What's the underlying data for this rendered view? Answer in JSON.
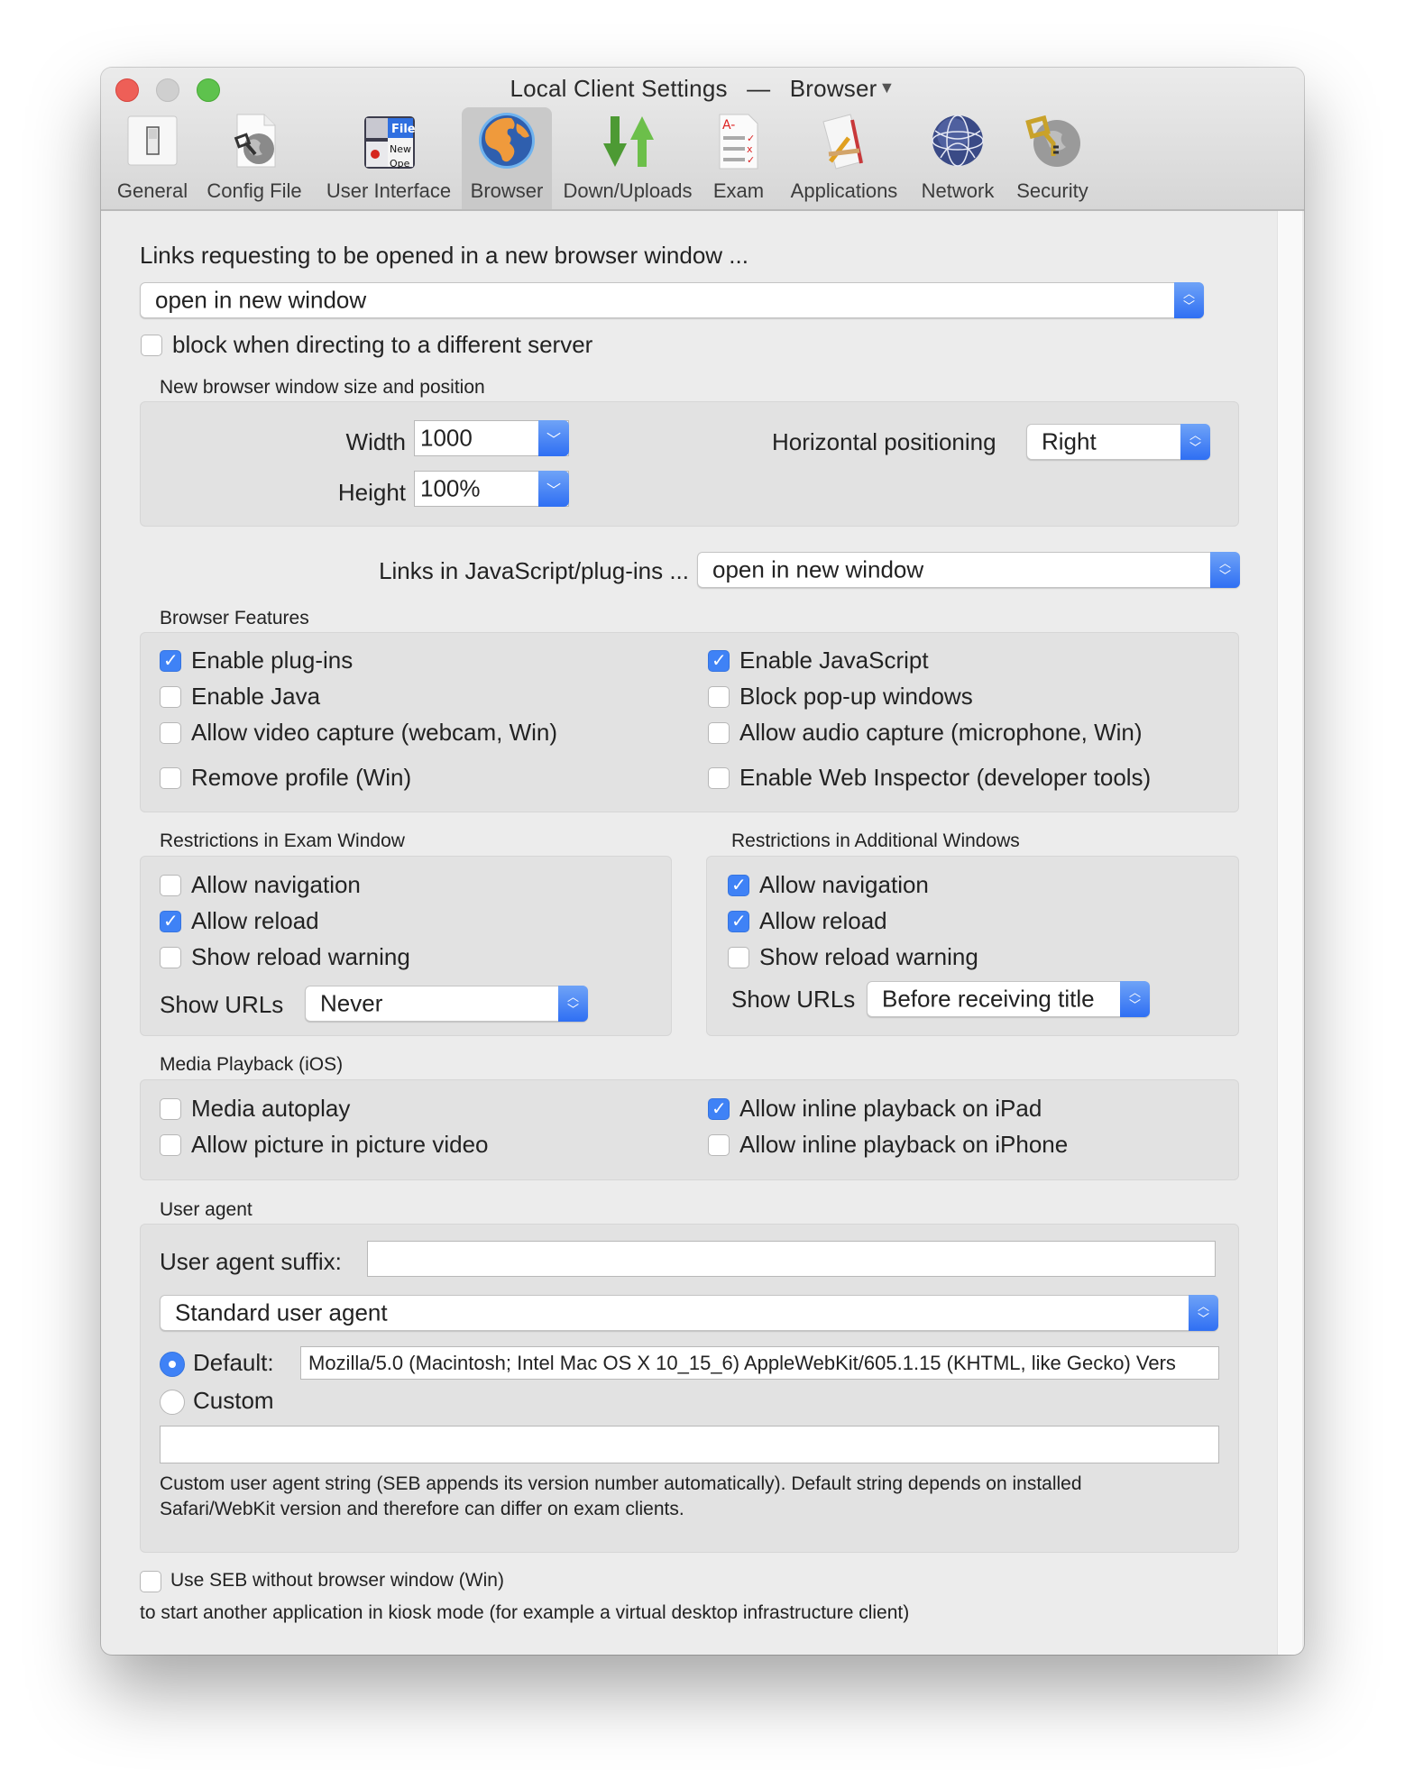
{
  "window": {
    "title": "Local Client Settings",
    "title_separator": "—",
    "subtitle": "Browser",
    "title_menu_icon": "▼"
  },
  "toolbar": {
    "items": [
      {
        "label": "General",
        "icon": "switch-icon",
        "selected": false
      },
      {
        "label": "Config File",
        "icon": "config-file-icon",
        "selected": false
      },
      {
        "label": "User Interface",
        "icon": "user-interface-icon",
        "selected": false
      },
      {
        "label": "Browser",
        "icon": "globe-icon",
        "selected": true
      },
      {
        "label": "Down/Uploads",
        "icon": "down-up-arrows-icon",
        "selected": false
      },
      {
        "label": "Exam",
        "icon": "exam-sheet-icon",
        "selected": false
      },
      {
        "label": "Applications",
        "icon": "applications-icon",
        "selected": false
      },
      {
        "label": "Network",
        "icon": "network-globe-icon",
        "selected": false
      },
      {
        "label": "Security",
        "icon": "security-key-icon",
        "selected": false
      }
    ]
  },
  "new_window_links": {
    "heading": "Links requesting to be opened in a new browser window ...",
    "policy_value": "open in new window",
    "block_label": "block when directing to a different server",
    "block_checked": false
  },
  "window_size": {
    "group_label": "New browser window size and position",
    "width_label": "Width",
    "width_value": "1000",
    "height_label": "Height",
    "height_value": "100%",
    "hpos_label": "Horizontal positioning",
    "hpos_value": "Right"
  },
  "js_links": {
    "label": "Links in JavaScript/plug-ins ...",
    "value": "open in new window"
  },
  "browser_features": {
    "group_label": "Browser Features",
    "left": [
      {
        "label": "Enable plug-ins",
        "checked": true
      },
      {
        "label": "Enable Java",
        "checked": false
      },
      {
        "label": "Allow video capture (webcam, Win)",
        "checked": false
      },
      {
        "label": "Remove profile (Win)",
        "checked": false
      }
    ],
    "right": [
      {
        "label": "Enable JavaScript",
        "checked": true
      },
      {
        "label": "Block pop-up windows",
        "checked": false
      },
      {
        "label": "Allow audio capture (microphone, Win)",
        "checked": false
      },
      {
        "label": "Enable Web Inspector (developer tools)",
        "checked": false
      }
    ]
  },
  "exam_restrictions": {
    "group_label": "Restrictions in Exam Window",
    "items": [
      {
        "label": "Allow navigation",
        "checked": false
      },
      {
        "label": "Allow reload",
        "checked": true
      },
      {
        "label": "Show reload warning",
        "checked": false
      }
    ],
    "show_urls_label": "Show URLs",
    "show_urls_value": "Never"
  },
  "additional_restrictions": {
    "group_label": "Restrictions in Additional Windows",
    "items": [
      {
        "label": "Allow navigation",
        "checked": true
      },
      {
        "label": "Allow reload",
        "checked": true
      },
      {
        "label": "Show reload warning",
        "checked": false
      }
    ],
    "show_urls_label": "Show URLs",
    "show_urls_value": "Before receiving title"
  },
  "media_playback": {
    "group_label": "Media Playback (iOS)",
    "left": [
      {
        "label": "Media autoplay",
        "checked": false
      },
      {
        "label": "Allow picture in picture video",
        "checked": false
      }
    ],
    "right": [
      {
        "label": "Allow inline playback on iPad",
        "checked": true
      },
      {
        "label": "Allow inline playback on iPhone",
        "checked": false
      }
    ]
  },
  "user_agent": {
    "group_label": "User agent",
    "suffix_label": "User agent suffix:",
    "suffix_value": "",
    "mode_value": "Standard user agent",
    "default_label": "Default:",
    "default_selected": true,
    "default_value": "Mozilla/5.0 (Macintosh; Intel Mac OS X 10_15_6) AppleWebKit/605.1.15 (KHTML, like Gecko) Vers",
    "custom_label": "Custom",
    "custom_selected": false,
    "custom_value": "",
    "help_line1": "Custom user agent string (SEB appends its version number automatically). Default string depends on installed",
    "help_line2": "Safari/WebKit version and therefore can differ on exam clients."
  },
  "no_browser": {
    "label": "Use SEB without browser window (Win)",
    "checked": false,
    "description": "to start another application in kiosk mode (for example a virtual desktop infrastructure client)"
  },
  "colors": {
    "accent": "#3f82f6",
    "window_bg": "#ececec",
    "group_bg": "#e2e2e2",
    "close": "#ee5f57",
    "minimize": "#cfcfcf",
    "zoom": "#5ec24d"
  }
}
